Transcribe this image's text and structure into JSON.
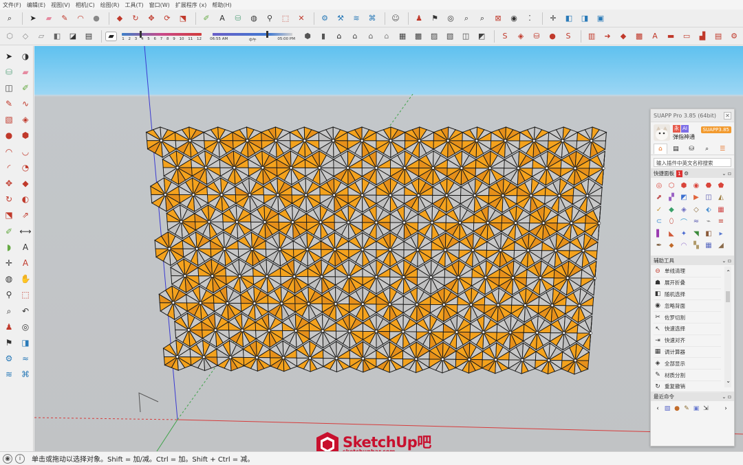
{
  "menu": [
    "文件(F)",
    "编辑(E)",
    "视图(V)",
    "相机(C)",
    "绘图(R)",
    "工具(T)",
    "窗口(W)",
    "扩展程序 (x)",
    "帮助(H)"
  ],
  "toolbar1_icons": [
    "zoom-extents-icon",
    "select-arrow-icon",
    "eraser-icon",
    "pencil-icon",
    "arc-icon",
    "orbit-sphere-icon",
    "push-pull-red-icon",
    "rotate-icon",
    "move-cross-icon",
    "rotate-red-icon",
    "scale-icon",
    "tape-measure-icon",
    "text-label-icon",
    "paint-bucket-icon",
    "orbit-icon",
    "zoom-icon",
    "zoom-window-icon",
    "hammer-icon",
    "gear-component-icon",
    "cross-section-icon",
    "stack-layers-icon",
    "network-icon",
    "user-icon",
    "position-camera-icon",
    "walk-icon",
    "look-around-icon",
    "zoom-glass-icon",
    "zoom-extents-icon",
    "footprint-icon",
    "eye-icon",
    "footsteps-icon",
    "axes-icon",
    "x-ray-icon",
    "back-edges-icon",
    "wireframe-icon"
  ],
  "toolbar2_icons": [
    "iso-view-icon",
    "top-view-icon",
    "front-view-icon",
    "right-view-icon",
    "back-view-icon",
    "left-view-icon"
  ],
  "toolbar2_right_icons": [
    "xray-style-icon",
    "hidden-line-icon",
    "house-icon",
    "house-section-icon",
    "house-outline-icon",
    "house-front-icon",
    "shaded-icon",
    "shaded-texture-icon",
    "monochrome-icon",
    "wire-style-icon",
    "component-icon",
    "group-icon",
    "suapp-logo-icon",
    "red-tool-icon",
    "red-bucket-icon",
    "red-sphere-icon",
    "red-s-icon",
    "warehouse-icon",
    "red-arrow-icon",
    "dynamic-component-icon",
    "material-icon",
    "3d-text-icon",
    "bed-icon",
    "sofa-icon",
    "stair-icon",
    "chart-icon",
    "gears-icon"
  ],
  "shadow": {
    "months": [
      "1",
      "2",
      "3",
      "4",
      "5",
      "6",
      "7",
      "8",
      "9",
      "10",
      "11",
      "12"
    ],
    "time_start": "06:55 AM",
    "time_mid": "中午",
    "time_end": "05:00 PM"
  },
  "left_toolbar_icons": [
    "select-arrow-icon",
    "eraser-round-icon",
    "paint-bucket-icon",
    "eraser-icon",
    "component-icon",
    "tape-measure-icon",
    "pencil-icon",
    "freehand-icon",
    "rectangle-icon",
    "rotated-rectangle-icon",
    "circle-icon",
    "polygon-icon",
    "arc-icon",
    "two-point-arc-icon",
    "three-point-arc-icon",
    "pie-icon",
    "move-icon",
    "push-pull-icon",
    "rotate-icon",
    "follow-me-icon",
    "scale-icon",
    "offset-icon",
    "tape-measure-icon",
    "dimension-icon",
    "protractor-icon",
    "text-icon",
    "axes-icon",
    "3d-text-icon",
    "orbit-icon",
    "pan-icon",
    "zoom-icon",
    "zoom-window-icon",
    "zoom-extents-icon",
    "previous-view-icon",
    "position-camera-icon",
    "look-around-icon",
    "walk-icon",
    "section-plane-icon",
    "sandbox-icon",
    "sandbox-contour-icon",
    "smoove-icon",
    "stamp-icon"
  ],
  "status_text": "单击或拖动以选择对象。Shift = 加/减。Ctrl = 加。Shift + Ctrl = 减。",
  "watermark": {
    "brand": "SketchUp吧",
    "url": "sketchupbar.com"
  },
  "suapp": {
    "title": "SUAPP Pro 3.85 (64bit)",
    "username": "弹指神通",
    "badge_vip": "永",
    "badge_ai": "AI",
    "version_badge": "SUAPP3.85",
    "search_placeholder": "输入插件中英文名称搜索",
    "quick_panel_label": "快捷面板",
    "quick_panel_count": "1",
    "helper_label": "辅助工具",
    "recent_label": "最近命令",
    "helper_items": [
      {
        "icon": "⊖",
        "label": "单线清理"
      },
      {
        "icon": "☗",
        "label": "展开折叠"
      },
      {
        "icon": "◧",
        "label": "随机选择"
      },
      {
        "icon": "◉",
        "label": "忽略背面"
      },
      {
        "icon": "✂",
        "label": "佐罗切割"
      },
      {
        "icon": "↖",
        "label": "快速选择"
      },
      {
        "icon": "⇥",
        "label": "快速对齐"
      },
      {
        "icon": "▦",
        "label": "调计算器"
      },
      {
        "icon": "◈",
        "label": "全部显示"
      },
      {
        "icon": "✎",
        "label": "材质分割"
      },
      {
        "icon": "↻",
        "label": "重复撤销"
      }
    ]
  },
  "colors": {
    "pattern_orange": "#f4a21d",
    "pattern_grey": "#c8c8c8",
    "sky_top": "#5fc1ef",
    "ground": "#c1c3c5",
    "brand_red": "#c8102e"
  }
}
